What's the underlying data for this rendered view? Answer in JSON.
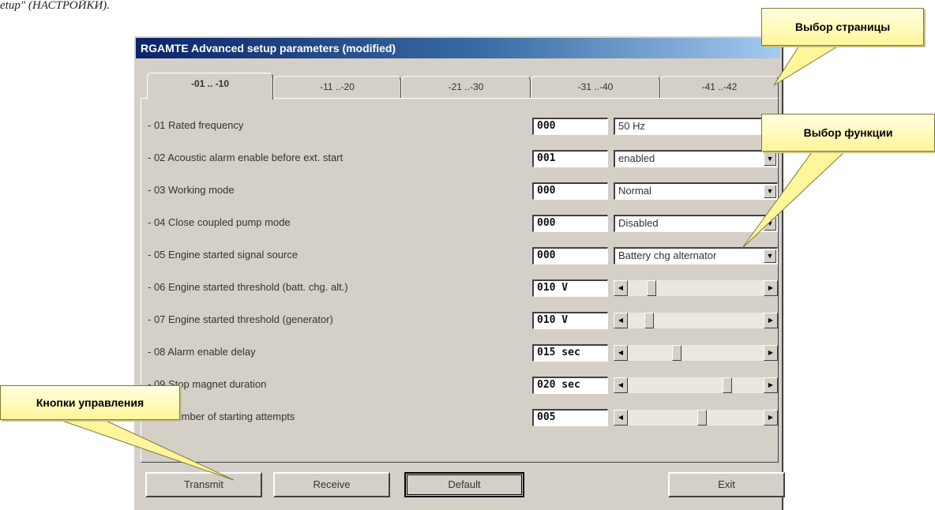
{
  "doc_fragment": "etup\" (НАСТРОЙКИ).",
  "window": {
    "title": "RGAMTE Advanced setup parameters (modified)"
  },
  "tabs": [
    {
      "label": "-01 .. -10",
      "active": true
    },
    {
      "label": "-11 ..-20",
      "active": false
    },
    {
      "label": "-21 ..-30",
      "active": false
    },
    {
      "label": "-31 ..-40",
      "active": false
    },
    {
      "label": "-41 ..-42",
      "active": false
    }
  ],
  "params": [
    {
      "label": "- 01 Rated frequency",
      "code": "000",
      "control": "combo",
      "value": "50 Hz"
    },
    {
      "label": "- 02 Acoustic alarm enable before ext. start",
      "code": "001",
      "control": "combo",
      "value": "enabled"
    },
    {
      "label": "- 03 Working mode",
      "code": "000",
      "control": "combo",
      "value": "Normal"
    },
    {
      "label": "- 04 Close coupled pump mode",
      "code": "000",
      "control": "combo",
      "value": "Disabled"
    },
    {
      "label": "- 05 Engine started signal source",
      "code": "000",
      "control": "combo",
      "value": "Battery chg alternator"
    },
    {
      "label": "- 06 Engine started threshold (batt. chg. alt.)",
      "code": "010 V",
      "control": "slider",
      "level": 0.15
    },
    {
      "label": "- 07 Engine started threshold (generator)",
      "code": "010 V",
      "control": "slider",
      "level": 0.13
    },
    {
      "label": "- 08 Alarm enable delay",
      "code": "015 sec",
      "control": "slider",
      "level": 0.35
    },
    {
      "label": "- 09 Stop magnet duration",
      "code": "020 sec",
      "control": "slider",
      "level": 0.75
    },
    {
      "label": "- 10 Number of starting attempts",
      "code": "005",
      "control": "slider",
      "level": 0.55
    }
  ],
  "buttons": {
    "transmit": "Transmit",
    "receive": "Receive",
    "default": "Default",
    "exit": "Exit"
  },
  "callouts": {
    "page_select": "Выбор страницы",
    "function_select": "Выбор функции",
    "control_buttons": "Кнопки управления"
  },
  "icons": {
    "dropdown": "chevron-down-icon",
    "scroll_left": "arrow-left-icon",
    "scroll_right": "arrow-right-icon"
  },
  "colors": {
    "title_bar_start": "#0a246a",
    "title_bar_end": "#a6caf0",
    "dialog_face": "#d4d0c8",
    "callout_fill": "#fff59a"
  }
}
